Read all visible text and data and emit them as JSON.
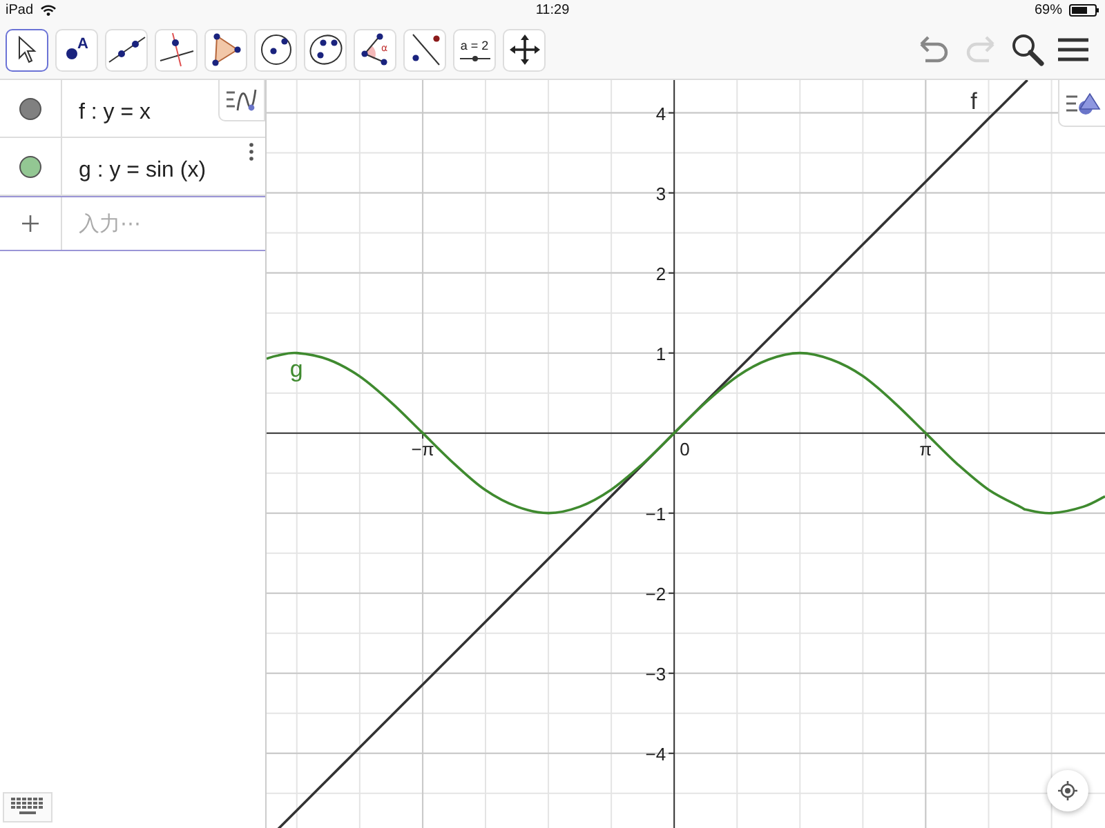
{
  "status_bar": {
    "device": "iPad",
    "time": "11:29",
    "battery": "69%"
  },
  "toolbar": {
    "tools": [
      {
        "kind": "move",
        "selected": true
      },
      {
        "kind": "point",
        "label": "A",
        "selected": false
      },
      {
        "kind": "line",
        "selected": false
      },
      {
        "kind": "perpendicular",
        "selected": false
      },
      {
        "kind": "polygon",
        "selected": false
      },
      {
        "kind": "circle",
        "selected": false
      },
      {
        "kind": "conic",
        "selected": false
      },
      {
        "kind": "angle",
        "label": "α",
        "selected": false
      },
      {
        "kind": "reflect",
        "selected": false
      },
      {
        "kind": "slider",
        "label": "a = 2",
        "selected": false
      },
      {
        "kind": "move-view",
        "selected": false
      }
    ],
    "actions": [
      {
        "kind": "undo",
        "disabled": false
      },
      {
        "kind": "redo",
        "disabled": true
      }
    ]
  },
  "algebra": {
    "items": [
      {
        "text": "f : y = x",
        "color": "#808080"
      },
      {
        "text": "g : y = sin (x)",
        "color": "#93c793"
      }
    ],
    "input": {
      "placeholder": "入力⋯"
    }
  },
  "graphics": {
    "chart_data": {
      "type": "line",
      "grid": true,
      "x": [
        -5.09,
        -4.95,
        -4.71,
        -4.32,
        -3.93,
        -3.53,
        -3.14,
        -2.75,
        -2.36,
        -1.96,
        -1.57,
        -1.18,
        -0.79,
        -0.39,
        0,
        0.39,
        0.79,
        1.18,
        1.57,
        1.96,
        2.36,
        2.75,
        3.14,
        3.53,
        3.93,
        4.32,
        4.41,
        4.71,
        5.11,
        5.38
      ],
      "series": [
        {
          "name": "f",
          "color": "#333333",
          "values": [
            null,
            -4.95,
            -4.71,
            -4.32,
            -3.93,
            -3.53,
            -3.14,
            -2.75,
            -2.36,
            -1.96,
            -1.57,
            -1.18,
            -0.79,
            -0.39,
            0,
            0.39,
            0.79,
            1.18,
            1.57,
            1.96,
            2.36,
            2.75,
            3.14,
            3.53,
            3.93,
            4.32,
            4.41,
            null,
            null,
            null
          ]
        },
        {
          "name": "g",
          "color": "#3f8a2f",
          "values": [
            0.93,
            0.97,
            1,
            0.92,
            0.71,
            0.38,
            0,
            -0.38,
            -0.71,
            -0.92,
            -1,
            -0.92,
            -0.71,
            -0.38,
            0,
            0.38,
            0.71,
            0.92,
            1,
            0.92,
            0.71,
            0.38,
            0,
            -0.38,
            -0.71,
            -0.92,
            -0.96,
            -1,
            -0.92,
            -0.79
          ]
        }
      ],
      "xlim": [
        -5.09,
        5.38
      ],
      "ylim": [
        -4.95,
        4.41
      ],
      "xticks": [
        {
          "value": -3.14,
          "label": "−π"
        },
        {
          "value": 3.14,
          "label": "π"
        }
      ],
      "yticks": [
        {
          "value": -4,
          "label": "−4"
        },
        {
          "value": -3,
          "label": "−3"
        },
        {
          "value": -2,
          "label": "−2"
        },
        {
          "value": -1,
          "label": "−1"
        },
        {
          "value": 1,
          "label": "1"
        },
        {
          "value": 2,
          "label": "2"
        },
        {
          "value": 3,
          "label": "3"
        },
        {
          "value": 4,
          "label": "4"
        }
      ]
    },
    "origin_label": "0"
  }
}
